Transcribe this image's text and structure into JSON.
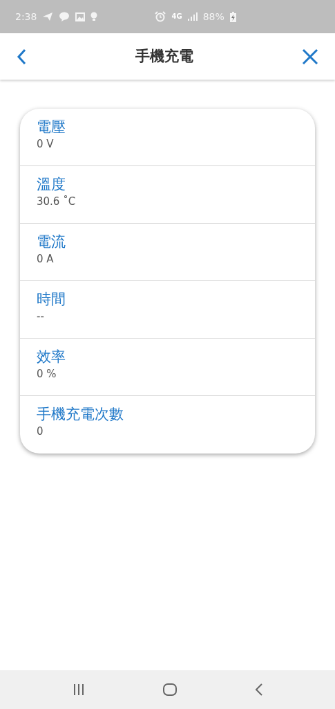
{
  "status_bar": {
    "time": "2:38",
    "network": "4G",
    "battery": "88%"
  },
  "header": {
    "title": "手機充電"
  },
  "items": [
    {
      "label": "電壓",
      "value": "0 V"
    },
    {
      "label": "溫度",
      "value": "30.6 ˚C"
    },
    {
      "label": "電流",
      "value": "0 A"
    },
    {
      "label": "時間",
      "value": "--"
    },
    {
      "label": "效率",
      "value": "0 %"
    },
    {
      "label": "手機充電次數",
      "value": "0"
    }
  ]
}
